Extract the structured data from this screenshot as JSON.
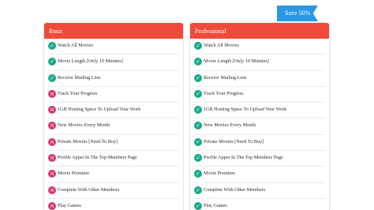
{
  "ribbon": {
    "label": "Save 50%",
    "color": "#2b98e4"
  },
  "colors": {
    "header": "#ef4a3c",
    "included": "#19a98d",
    "excluded": "#d83a6a"
  },
  "plans": [
    {
      "name": "Basic",
      "features": [
        {
          "label": "Watch All Movies",
          "included": true,
          "icon": "check-icon"
        },
        {
          "label": "Movie Length [Only 10 Minutes]",
          "included": true,
          "icon": "check-icon"
        },
        {
          "label": "Receive Mailing Lists",
          "included": true,
          "icon": "check-icon"
        },
        {
          "label": "Track Your Progress",
          "included": false,
          "icon": "cross-icon"
        },
        {
          "label": "1GB Hosting Space To Upload Your Work",
          "included": false,
          "icon": "cross-icon"
        },
        {
          "label": "New Movies Every Month",
          "included": false,
          "icon": "cross-icon"
        },
        {
          "label": "Private Movies [Need To Buy]",
          "included": false,
          "icon": "cross-icon"
        },
        {
          "label": "Profile Apper In The Top Members Page",
          "included": false,
          "icon": "cross-icon"
        },
        {
          "label": "Movie Premiere",
          "included": false,
          "icon": "cross-icon"
        },
        {
          "label": "Complete With Other Members",
          "included": false,
          "icon": "cross-icon"
        },
        {
          "label": "Play Games",
          "included": false,
          "icon": "cross-icon"
        }
      ]
    },
    {
      "name": "Professional",
      "features": [
        {
          "label": "Watch All Movies",
          "included": true,
          "icon": "check-icon"
        },
        {
          "label": "Movie Length [Only 10 Minutes]",
          "included": true,
          "icon": "check-icon"
        },
        {
          "label": "Receive Mailing Lists",
          "included": true,
          "icon": "check-icon"
        },
        {
          "label": "Track Your Progress",
          "included": true,
          "icon": "check-icon"
        },
        {
          "label": "1GB Hosting Space To Upload Your Work",
          "included": true,
          "icon": "check-icon"
        },
        {
          "label": "New Movies Every Month",
          "included": true,
          "icon": "check-icon"
        },
        {
          "label": "Private Movies [Need To Buy]",
          "included": true,
          "icon": "check-icon"
        },
        {
          "label": "Profile Apper In The Top Members Page",
          "included": true,
          "icon": "check-icon"
        },
        {
          "label": "Movie Premiere",
          "included": true,
          "icon": "check-icon"
        },
        {
          "label": "Complete With Other Members",
          "included": true,
          "icon": "check-icon"
        },
        {
          "label": "Play Games",
          "included": true,
          "icon": "check-icon"
        }
      ]
    }
  ]
}
